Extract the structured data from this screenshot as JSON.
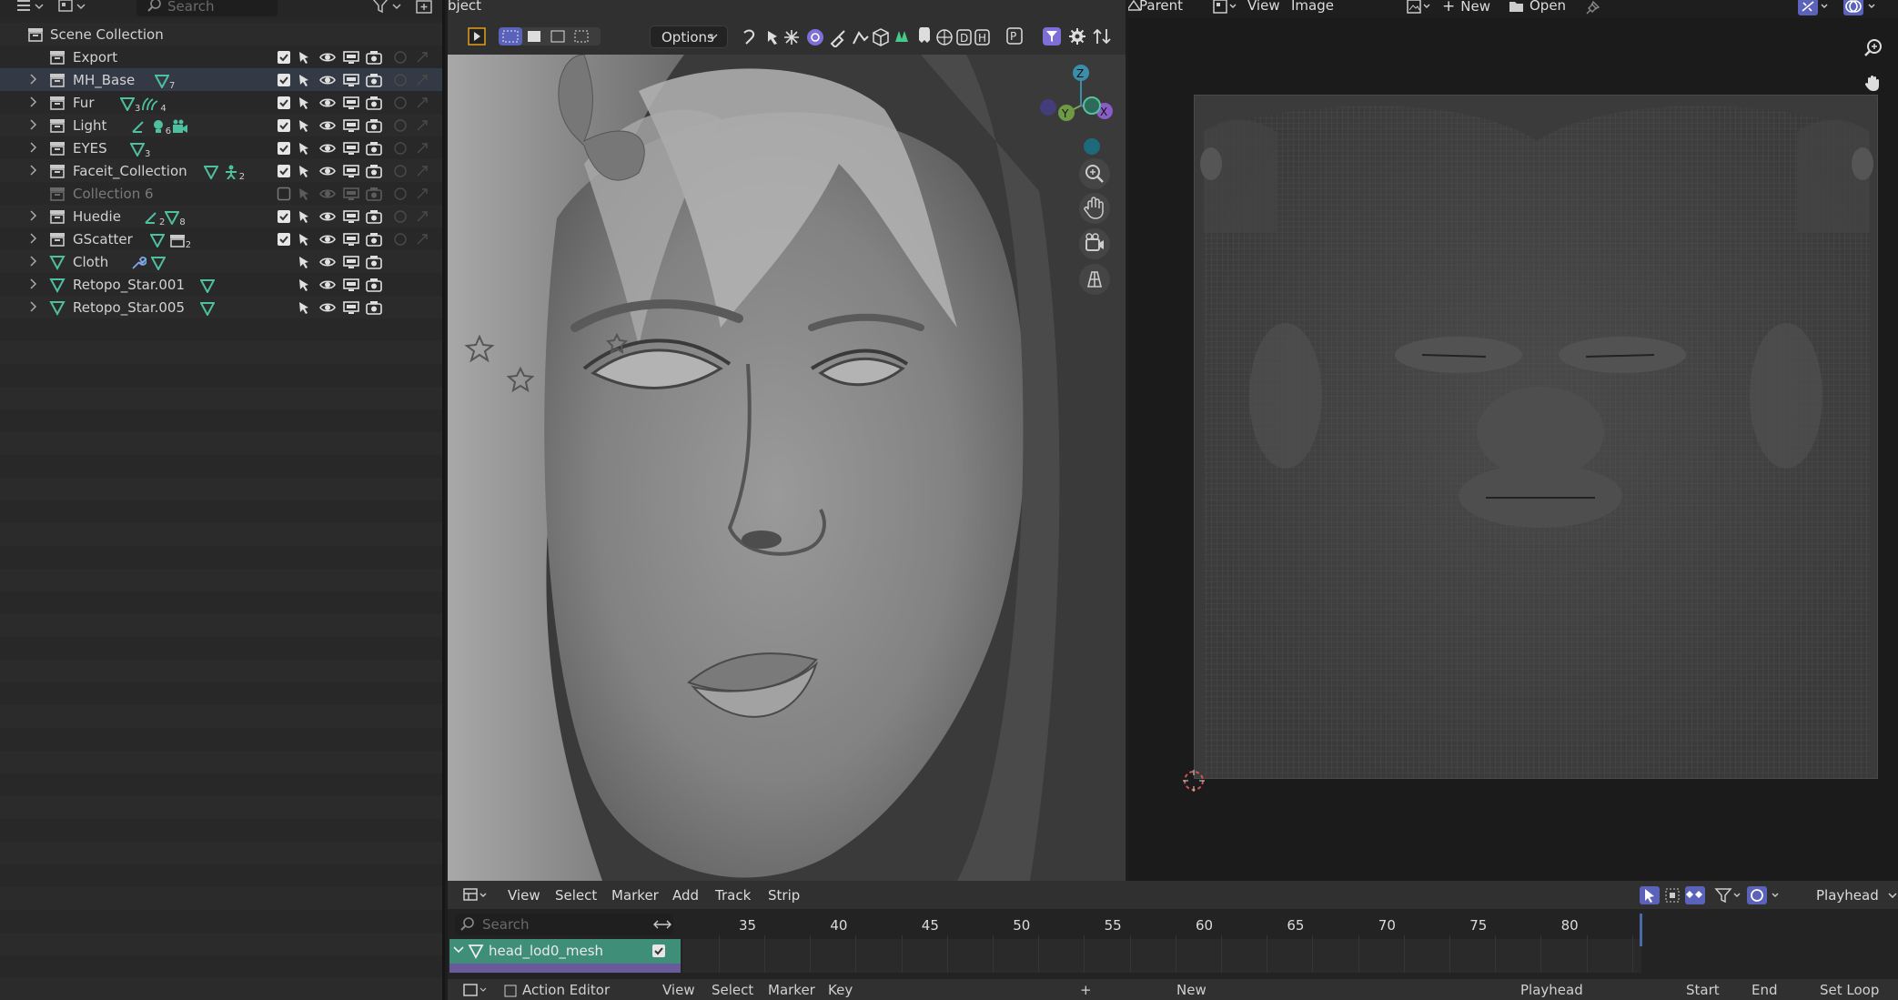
{
  "outliner": {
    "search_placeholder": "Search",
    "root_label": "Scene Collection",
    "rows": [
      {
        "label": "Export"
      },
      {
        "label": "MH_Base",
        "badge_count": "7"
      },
      {
        "label": "Fur",
        "badge_count_1": "3",
        "badge_count_2": "4"
      },
      {
        "label": "Light",
        "badge_count": "6"
      },
      {
        "label": "EYES",
        "badge_count": "3"
      },
      {
        "label": "Faceit_Collection",
        "badge_count": "2"
      },
      {
        "label": "Collection 6"
      },
      {
        "label": "Huedie",
        "badge_count_1": "2",
        "badge_count_2": "8"
      },
      {
        "label": "GScatter",
        "badge_count": "2"
      },
      {
        "label": "Cloth"
      },
      {
        "label": "Retopo_Star.001"
      },
      {
        "label": "Retopo_Star.005"
      }
    ]
  },
  "viewport": {
    "header_label": "bject",
    "options_label": "Options",
    "gizmo": {
      "z": "Z",
      "y": "Y",
      "x": "X"
    },
    "toggle_letters": [
      "D",
      "H",
      "P"
    ],
    "accent": "#7e6fd8"
  },
  "uv_editor": {
    "parent_label": "Parent",
    "menu_view": "View",
    "menu_image": "Image",
    "new_label": "New",
    "open_label": "Open"
  },
  "dope_sheet": {
    "menus": [
      "View",
      "Select",
      "Marker",
      "Add",
      "Track",
      "Strip"
    ],
    "playhead_label": "Playhead",
    "search_placeholder": "Search",
    "frames": [
      "35",
      "40",
      "45",
      "50",
      "55",
      "60",
      "65",
      "70",
      "75",
      "80"
    ],
    "channel_label": "head_lod0_mesh",
    "action_bar": {
      "editor": "Action Editor",
      "view": "View",
      "select": "Select",
      "marker": "Marker",
      "key": "Key",
      "new": "New",
      "playhead": "Playhead",
      "start": "Start",
      "end": "End",
      "set_loop": "Set Loop"
    }
  },
  "colors": {
    "accent_teal": "#4fbf9f",
    "accent_purple": "#7e6fd8",
    "selected_row": "#333a45",
    "channel_green": "#3f8f78"
  }
}
